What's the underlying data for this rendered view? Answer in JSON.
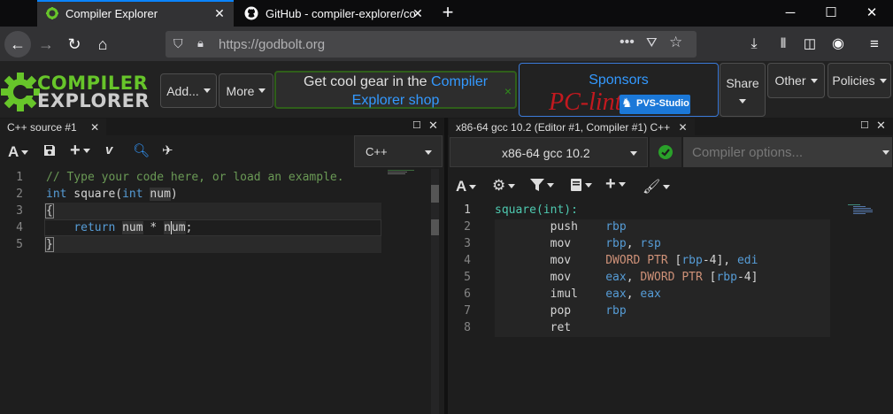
{
  "browser": {
    "tabs": [
      {
        "title": "Compiler Explorer",
        "active": true
      },
      {
        "title": "GitHub - compiler-explorer/compiler-explorer",
        "active": false
      }
    ],
    "url": "https://godbolt.org"
  },
  "header": {
    "logo_line1": "COMPILER",
    "logo_line2": "EXPLORER",
    "add_label": "Add...",
    "more_label": "More",
    "promo_prefix": "Get cool gear in the ",
    "promo_link1": "Compiler",
    "promo_link2": "Explorer shop",
    "promo_close": "×",
    "sponsors_label": "Sponsors",
    "sponsor1": "PC-lint",
    "sponsor2": "PVS-Studio",
    "share_label": "Share",
    "other_label": "Other",
    "policies_label": "Policies"
  },
  "editor": {
    "tab_title": "C++ source #1",
    "language": "C++",
    "line_numbers": [
      "1",
      "2",
      "3",
      "4",
      "5"
    ]
  },
  "compiler": {
    "tab_title": "x86-64 gcc 10.2 (Editor #1, Compiler #1) C++",
    "compiler_name": "x86-64 gcc 10.2",
    "options_placeholder": "Compiler options...",
    "line_numbers": [
      "1",
      "2",
      "3",
      "4",
      "5",
      "6",
      "7",
      "8"
    ]
  },
  "colors": {
    "accent": "#67c52a",
    "link": "#3399ff",
    "keyword": "#569cd6",
    "comment": "#6a9955",
    "label": "#4ec9b0",
    "ptr": "#ce9178"
  }
}
